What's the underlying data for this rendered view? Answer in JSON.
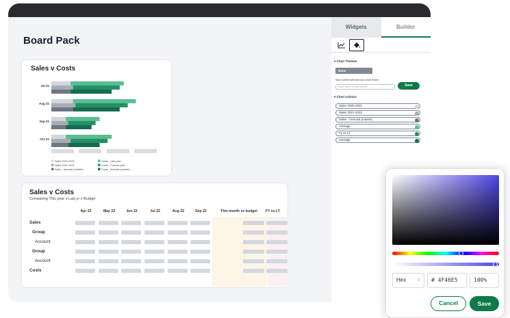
{
  "page": {
    "title": "Board Pack"
  },
  "chart_card": {
    "title": "Sales v Costs",
    "legend": [
      "Sales 2020-2021",
      "Costs - Last year",
      "Sales 2021-2022",
      "Costs - Current year",
      "Sales - forecast (master)",
      "Costs - forecast (master)"
    ]
  },
  "chart_data": {
    "type": "bar",
    "orientation": "horizontal",
    "title": "Sales v Costs",
    "categories": [
      "Jul 21",
      "Aug 21",
      "Sep 21",
      "Oct 21"
    ],
    "series": [
      {
        "name": "Sales 2020-2021",
        "values": [
          8,
          9,
          6,
          6
        ],
        "color": "#d3d7dc"
      },
      {
        "name": "Costs - Last year",
        "values": [
          18,
          21,
          12,
          15
        ],
        "color": "#5bbd93"
      },
      {
        "name": "Sales 2021-2022",
        "values": [
          9,
          10,
          7,
          8
        ],
        "color": "#a7adb4"
      },
      {
        "name": "Costs - Current year",
        "values": [
          17,
          19,
          11,
          14
        ],
        "color": "#229167"
      },
      {
        "name": "Sales - forecast (master)",
        "values": [
          8,
          9,
          6,
          7
        ],
        "color": "#6e7882"
      },
      {
        "name": "Costs - forecast (master)",
        "values": [
          15,
          17,
          10,
          12
        ],
        "color": "#176b4e"
      }
    ],
    "xlim": [
      0,
      24
    ],
    "x_tick_labels_visible": false
  },
  "table_card": {
    "title": "Sales v Costs",
    "subtitle": "Comparing This year v Last yr v Budget",
    "columns": [
      "Apr 22",
      "May 22",
      "Jun 22",
      "Jul 22",
      "Aug 22",
      "Sep 22",
      "This month vs budget",
      "FY vs LY"
    ],
    "rows": [
      "Sales",
      "Group",
      "Account",
      "Group",
      "Account",
      "Costs"
    ]
  },
  "panel": {
    "tabs": [
      "Widgets",
      "Builder"
    ],
    "active_tab": "Builder",
    "chart_themes_title": "Chart Themes",
    "theme_selected": "None",
    "save_prompt": "Save current selection as a chart theme",
    "theme_name_placeholder": "Enter name of chart theme",
    "save_button": "Save",
    "chart_colours_title": "Chart colours",
    "colours": [
      {
        "label": "Sales 2020-2021",
        "color": "#d3d7dc"
      },
      {
        "label": "Sales 2021-2022",
        "color": "#a7adb4"
      },
      {
        "label": "Sales - forecast (master)",
        "color": "#6e7882"
      },
      {
        "label": "Average",
        "color": "#5bbd93"
      },
      {
        "label": "Fy vs LY",
        "color": "#229167"
      },
      {
        "label": "Average",
        "color": "#176b4e"
      }
    ]
  },
  "picker": {
    "format": "Hex",
    "hex_value": "# 4F46E5",
    "opacity": "100%",
    "color": "#4f46e5",
    "cancel": "Cancel",
    "save": "Save"
  }
}
